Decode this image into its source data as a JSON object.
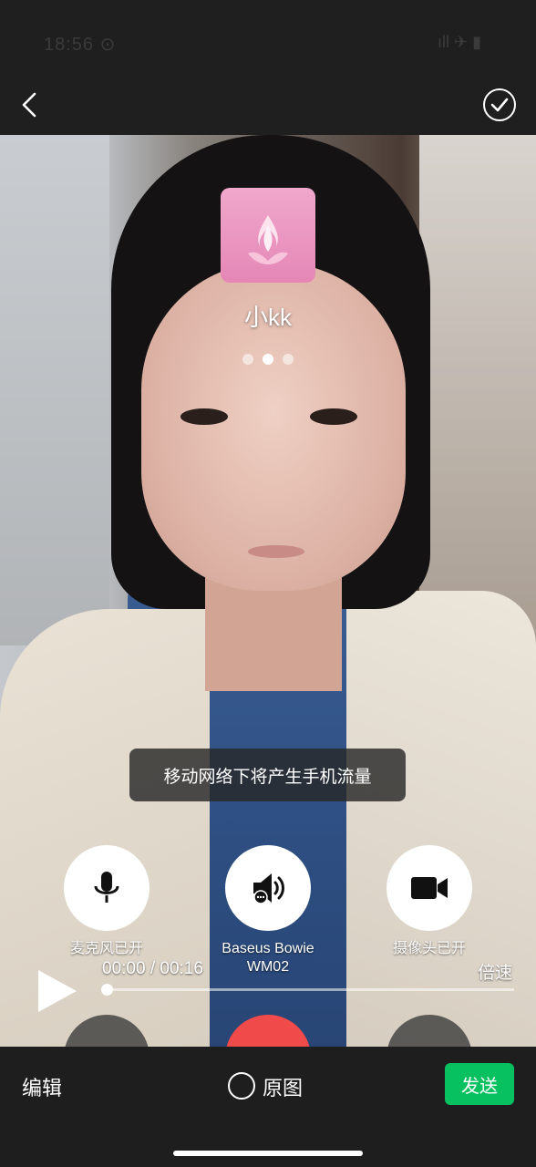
{
  "status_bar": {
    "time": "18:56",
    "time_suffix": "⊙",
    "right": "ıll  ✈  ▮"
  },
  "top_bar": {
    "back_icon": "chevron-left-icon",
    "confirm_icon": "check-circle-icon"
  },
  "call_overlay": {
    "contact_name": "小kk",
    "avatar_icon": "lotus-flame-icon",
    "page_dots": 3,
    "active_dot": 1,
    "toast": "移动网络下将产生手机流量",
    "buttons": [
      {
        "id": "mic",
        "icon": "microphone-icon",
        "label": "麦克风已开"
      },
      {
        "id": "speaker",
        "icon": "speaker-icon",
        "label_line1": "Baseus Bowie",
        "label_line2": "WM02"
      },
      {
        "id": "camera",
        "icon": "video-camera-icon",
        "label": "摄像头已开"
      }
    ]
  },
  "video_player": {
    "play_icon": "play-icon",
    "time": "00:00 / 00:16",
    "speed_label": "倍速",
    "progress": 0.0
  },
  "bottom_bar": {
    "edit_label": "编辑",
    "original_label": "原图",
    "original_checked": false,
    "send_label": "发送"
  },
  "colors": {
    "accent": "#07c160",
    "hangup": "#f04a4a",
    "background": "#1e1e1e"
  }
}
